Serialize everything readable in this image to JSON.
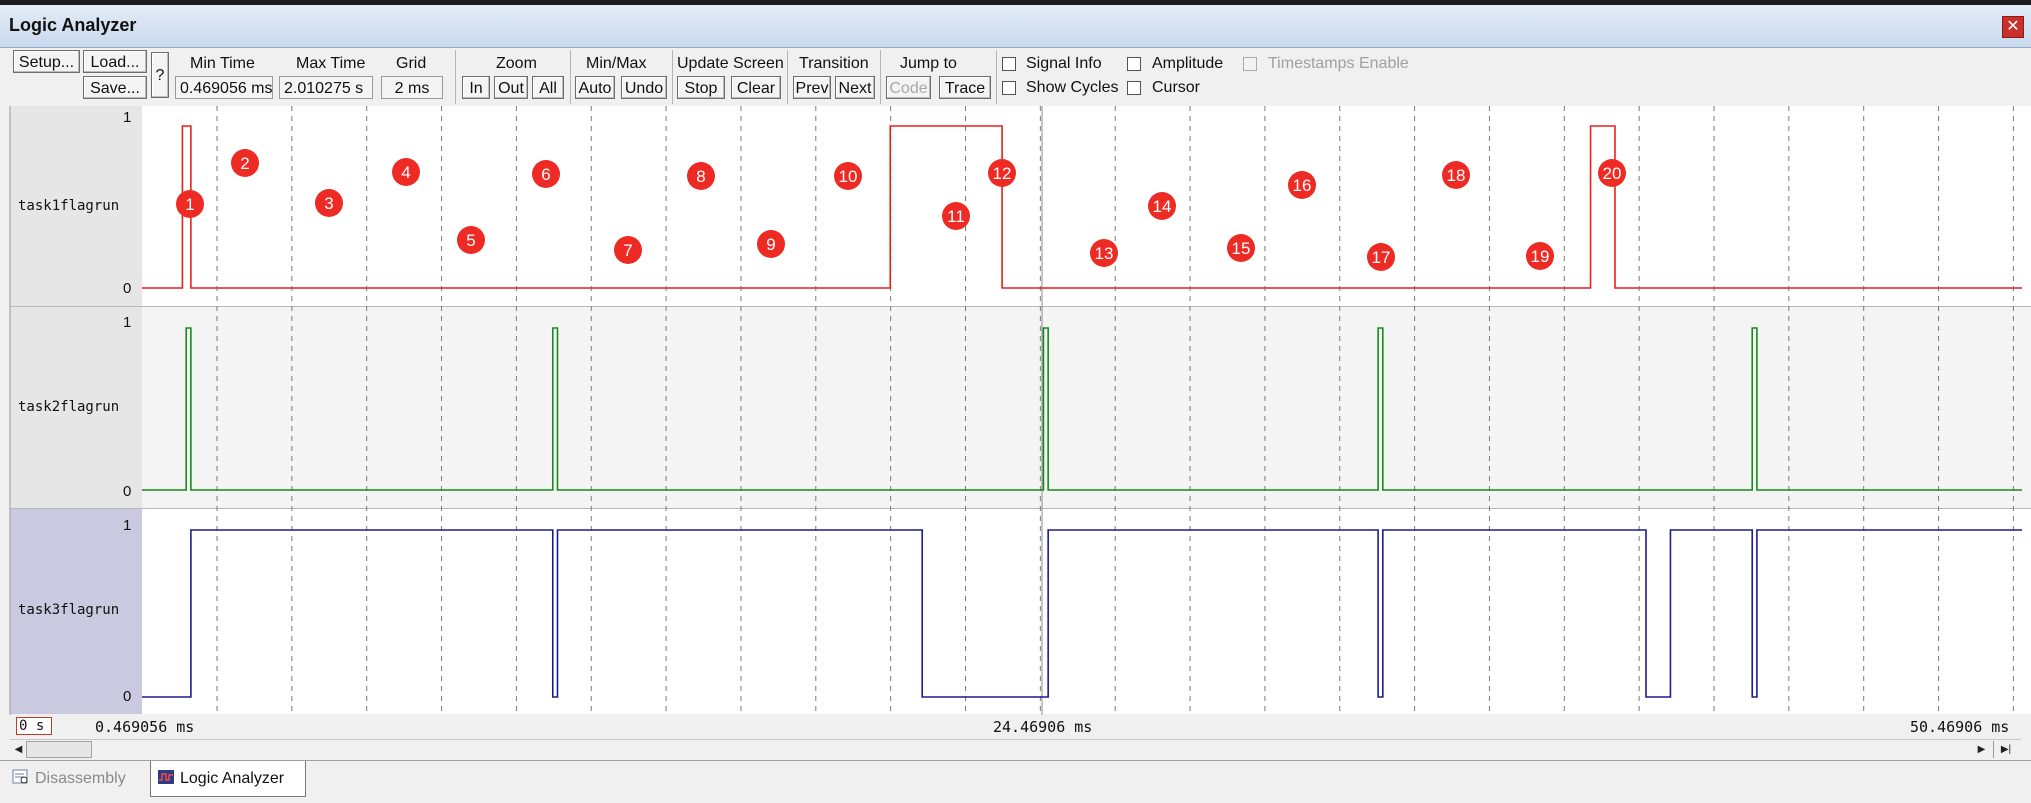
{
  "window": {
    "title": "Logic Analyzer",
    "close_glyph": "✕"
  },
  "toolbar": {
    "setup_label": "Setup...",
    "load_label": "Load...",
    "save_label": "Save...",
    "help_label": "?",
    "min_time_label": "Min Time",
    "min_time_value": "0.469056 ms",
    "max_time_label": "Max Time",
    "max_time_value": "2.010275 s",
    "grid_label": "Grid",
    "grid_value": "2 ms",
    "zoom_label": "Zoom",
    "zoom_in": "In",
    "zoom_out": "Out",
    "zoom_all": "All",
    "minmax_label": "Min/Max",
    "minmax_auto": "Auto",
    "minmax_undo": "Undo",
    "update_label": "Update Screen",
    "update_stop": "Stop",
    "update_clear": "Clear",
    "transition_label": "Transition",
    "transition_prev": "Prev",
    "transition_next": "Next",
    "jump_label": "Jump to",
    "jump_code": "Code",
    "jump_trace": "Trace",
    "signal_info": "Signal Info",
    "show_cycles": "Show Cycles",
    "amplitude": "Amplitude",
    "cursor": "Cursor",
    "timestamps": "Timestamps Enable"
  },
  "signals": [
    {
      "name": "task1flagrun",
      "color": "#e8201c",
      "high": "1",
      "low": "0",
      "segments": [
        [
          0,
          0
        ],
        [
          2.15,
          1
        ],
        [
          2.6,
          0
        ],
        [
          39.8,
          1
        ],
        [
          45.75,
          0
        ],
        [
          77.05,
          1
        ],
        [
          78.35,
          0
        ],
        [
          100,
          0
        ]
      ]
    },
    {
      "name": "task2flagrun",
      "color": "#1a8a1a",
      "high": "1",
      "low": "0",
      "segments": [
        [
          0,
          0
        ],
        [
          2.35,
          1
        ],
        [
          2.6,
          0
        ],
        [
          21.85,
          1
        ],
        [
          22.1,
          0
        ],
        [
          47.95,
          1
        ],
        [
          48.2,
          0
        ],
        [
          65.75,
          1
        ],
        [
          66.0,
          0
        ],
        [
          85.65,
          1
        ],
        [
          85.9,
          0
        ],
        [
          100,
          0
        ]
      ]
    },
    {
      "name": "task3flagrun",
      "color": "#1c1c8c",
      "high": "1",
      "low": "0",
      "segments": [
        [
          0,
          0
        ],
        [
          2.6,
          1
        ],
        [
          21.85,
          0
        ],
        [
          22.1,
          1
        ],
        [
          41.5,
          0
        ],
        [
          47.95,
          0
        ],
        [
          48.2,
          1
        ],
        [
          65.75,
          0
        ],
        [
          66.0,
          1
        ],
        [
          80.0,
          0
        ],
        [
          81.3,
          1
        ],
        [
          85.65,
          0
        ],
        [
          85.9,
          1
        ],
        [
          100,
          1
        ]
      ]
    }
  ],
  "markers": [
    "1",
    "2",
    "3",
    "4",
    "5",
    "6",
    "7",
    "8",
    "9",
    "10",
    "11",
    "12",
    "13",
    "14",
    "15",
    "16",
    "17",
    "18",
    "19",
    "20"
  ],
  "timebar": {
    "start_box": "0 s",
    "left_time": "0.469056 ms",
    "mid_time": "24.46906 ms",
    "right_time": "50.46906 ms"
  },
  "tabs": [
    {
      "label": "Disassembly",
      "active": false
    },
    {
      "label": "Logic Analyzer",
      "active": true
    }
  ]
}
